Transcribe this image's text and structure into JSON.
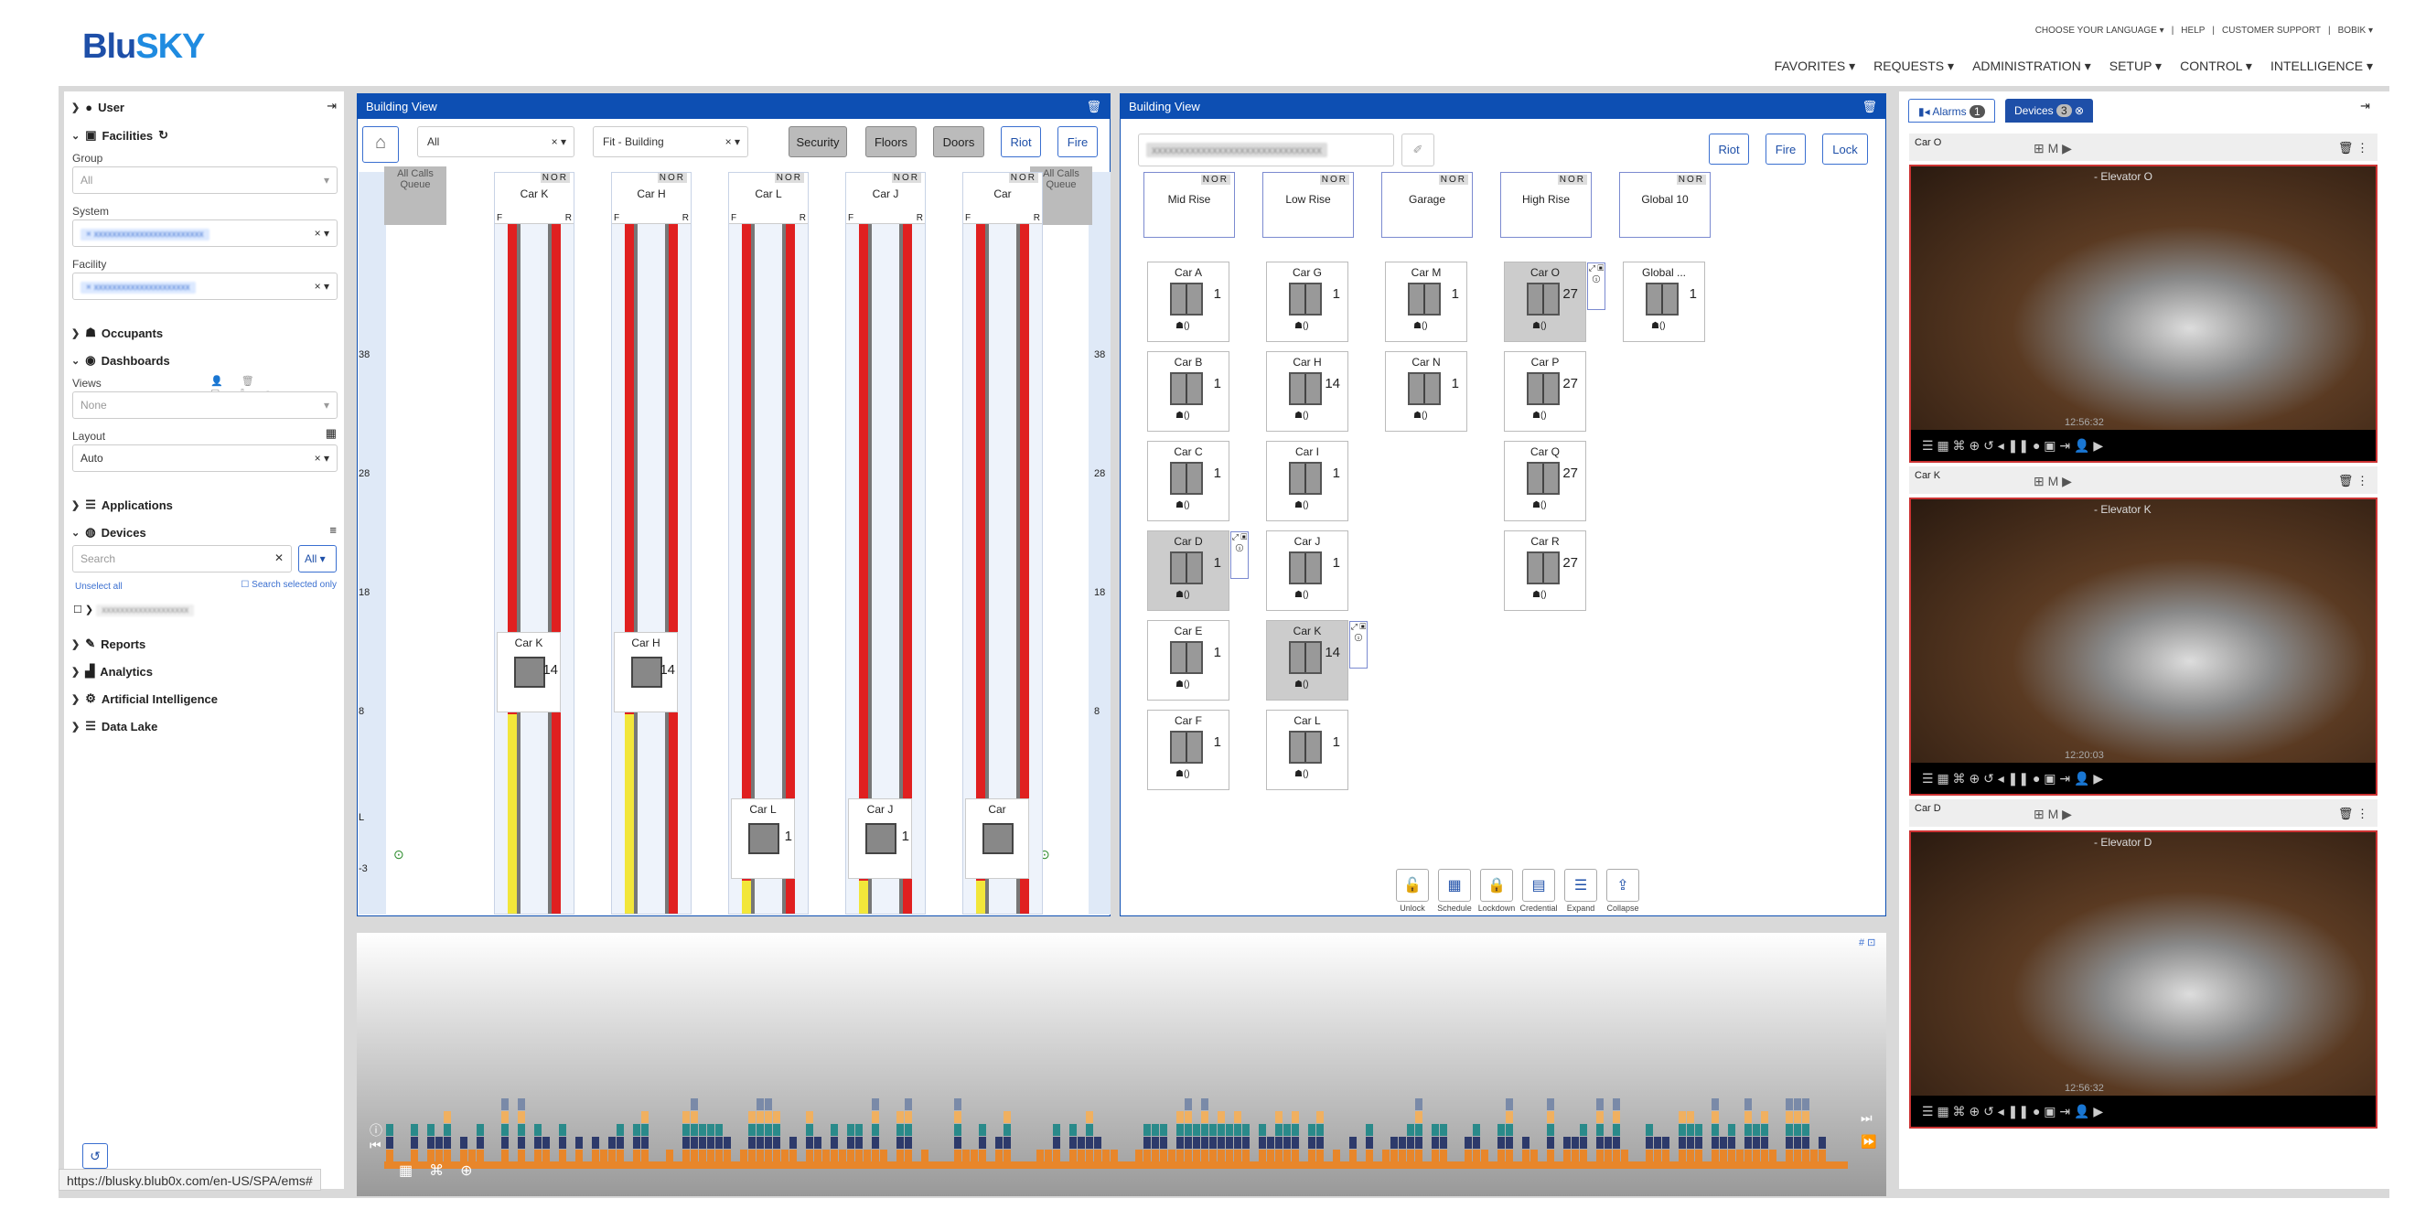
{
  "header": {
    "logo_a": "Blu",
    "logo_b": "SKY",
    "util": [
      "CHOOSE YOUR LANGUAGE ▾",
      "|",
      "HELP",
      "|",
      "CUSTOMER SUPPORT",
      "|",
      "BOBIK ▾"
    ],
    "nav": [
      "FAVORITES ▾",
      "REQUESTS ▾",
      "ADMINISTRATION ▾",
      "SETUP ▾",
      "CONTROL ▾",
      "INTELLIGENCE ▾"
    ]
  },
  "sidebar": {
    "user": "User",
    "facilities": "Facilities",
    "group_label": "Group",
    "group_value": "All",
    "system_label": "System",
    "facility_label": "Facility",
    "occupants": "Occupants",
    "dashboards": "Dashboards",
    "views_label": "Views",
    "views_value": "None",
    "layout_label": "Layout",
    "layout_value": "Auto",
    "applications": "Applications",
    "devices": "Devices",
    "search_placeholder": "Search",
    "all_btn": "All ▾",
    "unselect": "Unselect all",
    "search_selected": "Search selected only",
    "reports": "Reports",
    "analytics": "Analytics",
    "ai": "Artificial Intelligence",
    "datalake": "Data Lake"
  },
  "bv1": {
    "title": "Building View",
    "filter": "All",
    "fit": "Fit - Building",
    "btns": [
      "Security",
      "Floors",
      "Doors",
      "Riot",
      "Fire"
    ],
    "queue": "All Calls Queue",
    "floors": [
      "38",
      "28",
      "18",
      "8",
      "L",
      "-3"
    ],
    "shafts": [
      {
        "name": "Car K"
      },
      {
        "name": "Car H"
      },
      {
        "name": "Car L"
      },
      {
        "name": "Car J"
      },
      {
        "name": "Car"
      }
    ],
    "car_labels": [
      "Car K",
      "Car H",
      "Car L",
      "Car J",
      "Car"
    ],
    "car_floors": [
      "14",
      "14",
      "1",
      "1",
      ""
    ],
    "nor": "NOR",
    "f": "F",
    "r": "R"
  },
  "bv2": {
    "title": "Building View",
    "btns": [
      "Riot",
      "Fire",
      "Lock"
    ],
    "zones": [
      "Mid Rise",
      "Low Rise",
      "Garage",
      "High Rise",
      "Global 10"
    ],
    "cars": [
      {
        "n": "Car A",
        "f": "1"
      },
      {
        "n": "Car G",
        "f": "1"
      },
      {
        "n": "Car M",
        "f": "1"
      },
      {
        "n": "Car O",
        "f": "27"
      },
      {
        "n": "Global ...",
        "f": "1"
      },
      {
        "n": "Car B",
        "f": "1"
      },
      {
        "n": "Car H",
        "f": "14"
      },
      {
        "n": "Car N",
        "f": "1"
      },
      {
        "n": "Car P",
        "f": "27"
      },
      {
        "n": "Car C",
        "f": "1"
      },
      {
        "n": "Car I",
        "f": "1"
      },
      {
        "n": "Car Q",
        "f": "27"
      },
      {
        "n": "Car D",
        "f": "1"
      },
      {
        "n": "Car J",
        "f": "1"
      },
      {
        "n": "Car R",
        "f": "27"
      },
      {
        "n": "Car E",
        "f": "1"
      },
      {
        "n": "Car K",
        "f": "14"
      },
      {
        "n": "Car F",
        "f": "1"
      },
      {
        "n": "Car L",
        "f": "1"
      }
    ],
    "tools": [
      "Unlock",
      "Schedule",
      "Lockdown",
      "Credential",
      "Expand",
      "Collapse"
    ]
  },
  "right": {
    "tab_alarms": "Alarms",
    "alarms_count": "1",
    "tab_devices": "Devices",
    "devices_count": "3",
    "cams": [
      {
        "car": "Car O",
        "title": "- Elevator O",
        "time": "12:56:32"
      },
      {
        "car": "Car K",
        "title": "- Elevator K",
        "time": "12:20:03"
      },
      {
        "car": "Car D",
        "title": "- Elevator D",
        "time": "12:56:32"
      }
    ]
  },
  "status": "https://blusky.blub0x.com/en-US/SPA/ems#",
  "colors": {
    "brand": "#0d4fb3",
    "rail_red": "#e02020",
    "rail_yellow": "#f2e63a",
    "orange": "#e8862a",
    "teal": "#2a8a8a",
    "navy": "#2d3a6b"
  }
}
